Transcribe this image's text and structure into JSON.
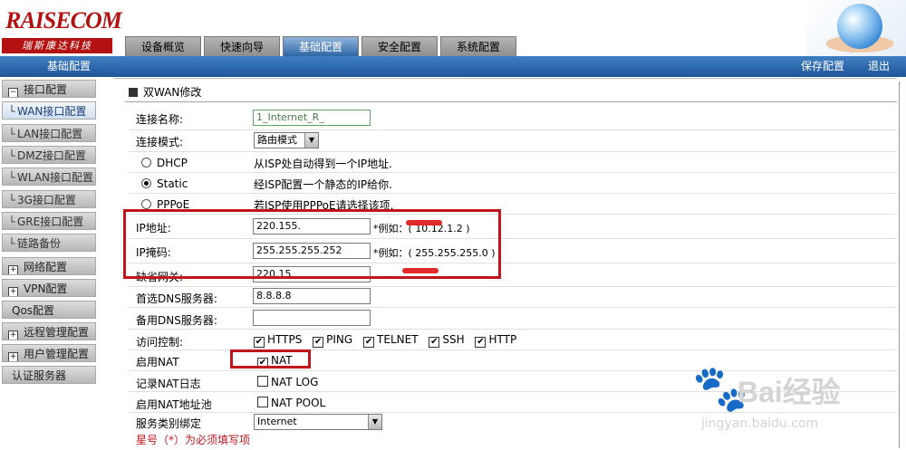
{
  "brand": {
    "logo": "RAISECOM",
    "logo_sub": "瑞斯康达科技"
  },
  "nav": {
    "tabs": [
      {
        "label": "设备概览"
      },
      {
        "label": "快速向导"
      },
      {
        "label": "基础配置"
      },
      {
        "label": "安全配置"
      },
      {
        "label": "系统配置"
      }
    ],
    "active_index": 2
  },
  "bluebar": {
    "crumb": "基础配置",
    "save": "保存配置",
    "logout": "退出"
  },
  "sidebar": {
    "items": [
      {
        "mark": "⊟",
        "label": "接口配置",
        "type": "group"
      },
      {
        "mark": "└",
        "label": "WAN接口配置",
        "type": "sub",
        "active": true
      },
      {
        "mark": "└",
        "label": "LAN接口配置",
        "type": "sub"
      },
      {
        "mark": "└",
        "label": "DMZ接口配置",
        "type": "sub"
      },
      {
        "mark": "└",
        "label": "WLAN接口配置",
        "type": "sub"
      },
      {
        "mark": "└",
        "label": "3G接口配置",
        "type": "sub"
      },
      {
        "mark": "└",
        "label": "GRE接口配置",
        "type": "sub"
      },
      {
        "mark": "└",
        "label": "链路备份",
        "type": "sub"
      },
      {
        "mark": "⊞",
        "label": "网络配置",
        "type": "group"
      },
      {
        "mark": "⊞",
        "label": "VPN配置",
        "type": "group"
      },
      {
        "mark": "",
        "label": "Qos配置",
        "type": "plain"
      },
      {
        "mark": "⊞",
        "label": "远程管理配置",
        "type": "group"
      },
      {
        "mark": "⊞",
        "label": "用户管理配置",
        "type": "group"
      },
      {
        "mark": "",
        "label": "认证服务器",
        "type": "plain"
      }
    ]
  },
  "form": {
    "title": "双WAN修改",
    "conn_name_label": "连接名称:",
    "conn_name_value": "1_Internet_R_",
    "conn_mode_label": "连接模式:",
    "conn_mode_value": "路由模式",
    "dhcp_label": "DHCP",
    "dhcp_desc": "从ISP处自动得到一个IP地址.",
    "static_label": "Static",
    "static_desc": "经ISP配置一个静态的IP给你.",
    "pppoe_label": "PPPoE",
    "pppoe_desc": "若ISP使用PPPoE请选择该项.",
    "selected_mode": "Static",
    "ip_label": "IP地址:",
    "ip_value": "220.155.",
    "ip_hint": "*例如：( 10.12.1.2 )",
    "mask_label": "IP掩码:",
    "mask_value": "255.255.255.252",
    "mask_hint": "*例如：( 255.255.255.0 )",
    "gw_label": "缺省网关:",
    "gw_value": "220.15",
    "dns1_label": "首选DNS服务器:",
    "dns1_value": "8.8.8.8",
    "dns2_label": "备用DNS服务器:",
    "dns2_value": "",
    "access_label": "访问控制:",
    "access": [
      {
        "label": "HTTPS",
        "checked": true
      },
      {
        "label": "PING",
        "checked": true
      },
      {
        "label": "TELNET",
        "checked": true
      },
      {
        "label": "SSH",
        "checked": true
      },
      {
        "label": "HTTP",
        "checked": true
      }
    ],
    "nat_label": "启用NAT",
    "nat_cb": "NAT",
    "natlog_label": "记录NAT日志",
    "natlog_cb": "NAT LOG",
    "natpool_label": "启用NAT地址池",
    "natpool_cb": "NAT POOL",
    "svc_label": "服务类别绑定",
    "svc_value": "Internet",
    "required_note": "星号（*）为必须填写项"
  },
  "watermark": {
    "text": "Bai经验",
    "url": "jingyan.baidu.com"
  }
}
